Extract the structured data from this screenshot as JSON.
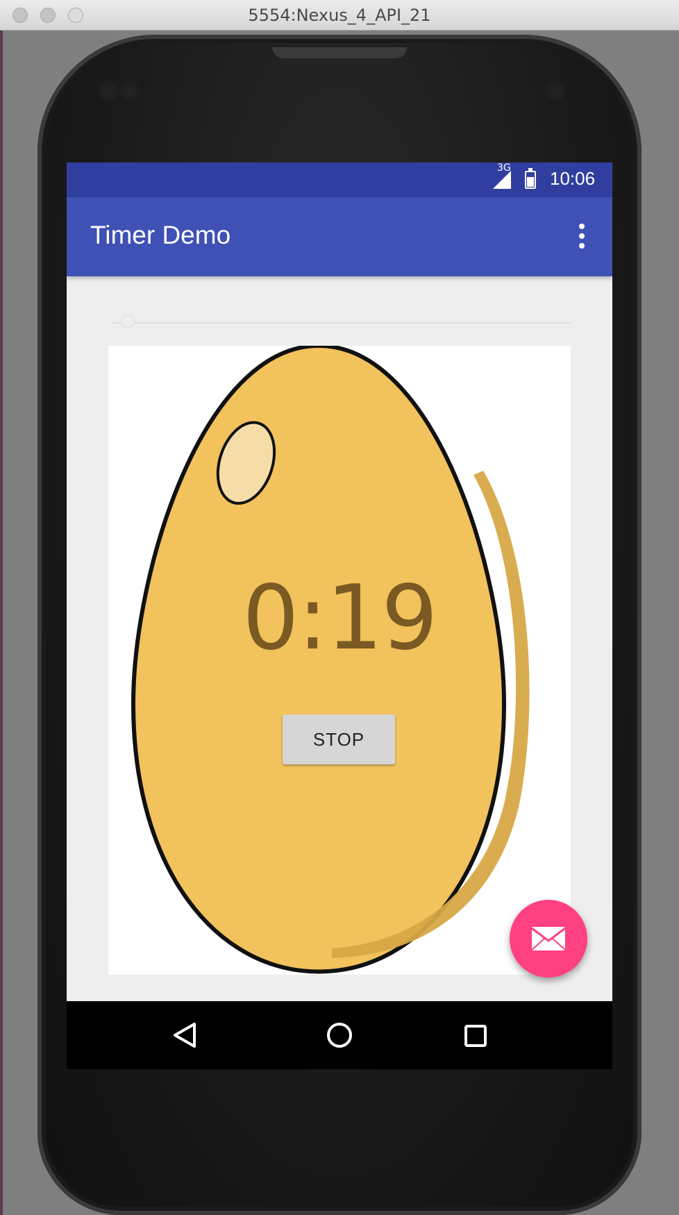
{
  "window": {
    "title": "5554:Nexus_4_API_21"
  },
  "status_bar": {
    "network": "3G",
    "time": "10:06"
  },
  "app_bar": {
    "title": "Timer Demo",
    "overflow_icon": "more-vert-icon"
  },
  "seekbar": {
    "progress": 0.05
  },
  "timer": {
    "display": "0:19"
  },
  "controls": {
    "stop_label": "STOP"
  },
  "fab": {
    "icon": "email-icon",
    "color": "#ff4081"
  },
  "nav_bar": {
    "icons": [
      "back-icon",
      "home-icon",
      "recents-icon"
    ]
  },
  "colors": {
    "status_bar": "#303f9f",
    "app_bar": "#3f51b5",
    "egg": "#f2c25c"
  }
}
